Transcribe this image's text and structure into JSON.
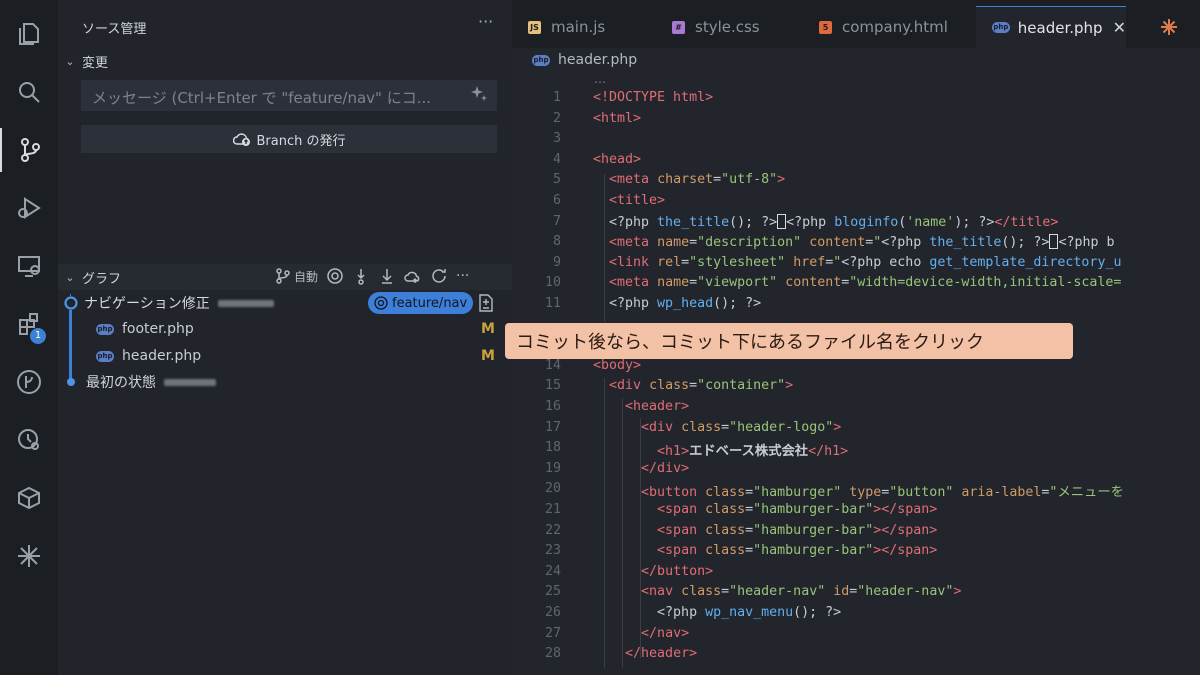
{
  "sidebar": {
    "title": "ソース管理",
    "more": "···",
    "changes_label": "変更",
    "commit_placeholder": "メッセージ (Ctrl+Enter で \"feature/nav\" にコ...",
    "publish_label": "Branch の発行",
    "graph_label": "グラフ",
    "auto_label": "自動",
    "commits": [
      {
        "message": "ナビゲーション修正",
        "branch": "feature/nav",
        "files": [
          {
            "name": "footer.php",
            "status": "M"
          },
          {
            "name": "header.php",
            "status": "M"
          }
        ]
      },
      {
        "message": "最初の状態"
      }
    ]
  },
  "badges": {
    "extensions": "1"
  },
  "tabs": [
    {
      "label": "main.js",
      "icon": "js-icon"
    },
    {
      "label": "style.css",
      "icon": "css-icon"
    },
    {
      "label": "company.html",
      "icon": "html-icon"
    },
    {
      "label": "header.php",
      "icon": "php-icon"
    }
  ],
  "close_glyph": "✕",
  "breadcrumb": {
    "file": "header.php",
    "more": "…"
  },
  "code": {
    "line_numbers": [
      "1",
      "2",
      "3",
      "4",
      "5",
      "6",
      "7",
      "8",
      "9",
      "10",
      "11",
      "14",
      "15",
      "16",
      "17",
      "18",
      "19",
      "20",
      "21",
      "22",
      "23",
      "24",
      "25",
      "26",
      "27",
      "28"
    ]
  },
  "annotation": "コミット後なら、コミット下にあるファイル名をクリック",
  "colors": {
    "accent": "#3b82d6",
    "callout": "#f3c1a6",
    "modified": "#c9a23f"
  }
}
